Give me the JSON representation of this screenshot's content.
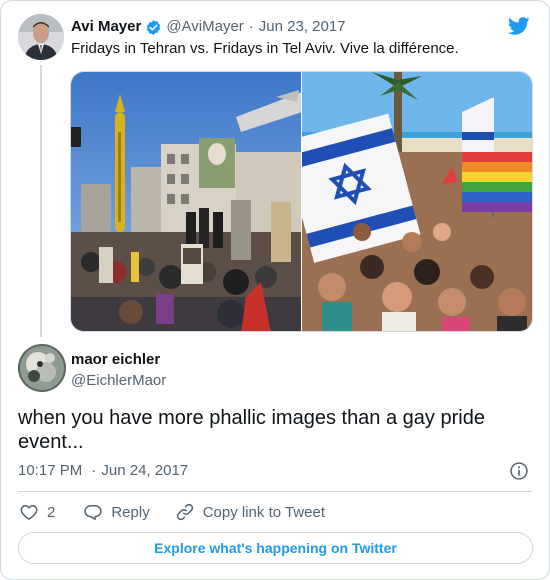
{
  "colors": {
    "accent": "#1d9bf0",
    "muted": "#536471",
    "border": "#cfd9de",
    "text": "#0f1419"
  },
  "icons": [
    "twitter-bird-icon",
    "verified-badge-icon",
    "heart-icon",
    "reply-bubble-icon",
    "link-icon",
    "info-icon"
  ],
  "original_tweet": {
    "author_name": "Avi Mayer",
    "handle": "@AviMayer",
    "date": "Jun 23, 2017",
    "text": "Fridays in Tehran vs. Fridays in Tel Aviv. Vive la différence."
  },
  "reply_tweet": {
    "author_name": "maor eichler",
    "handle": "@EichlerMaor",
    "text": "when you have more phallic images than a gay pride event...",
    "time": "10:17 PM",
    "date": "Jun 24, 2017",
    "likes": "2"
  },
  "actions": {
    "reply_label": "Reply",
    "copy_link_label": "Copy link to Tweet"
  },
  "explore_label": "Explore what's happening on Twitter"
}
